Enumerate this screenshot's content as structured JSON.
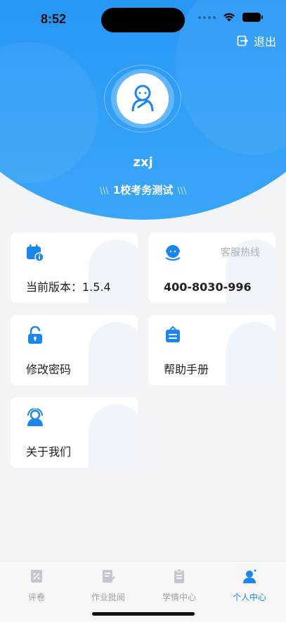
{
  "status_bar": {
    "time": "8:52"
  },
  "header": {
    "logout_label": "退出",
    "username": "zxj",
    "school_name": "1校考务测试",
    "slash_left": "\\\\\\",
    "slash_right": "\\\\\\"
  },
  "cards": {
    "version": {
      "label": "当前版本：1.5.4"
    },
    "hotline": {
      "title": "客服热线",
      "phone": "400-8030-996"
    },
    "change_password": {
      "label": "修改密码"
    },
    "help_manual": {
      "label": "帮助手册"
    },
    "about_us": {
      "label": "关于我们"
    }
  },
  "tabbar": {
    "items": [
      {
        "label": "评卷",
        "icon": "grading-icon"
      },
      {
        "label": "作业批阅",
        "icon": "homework-icon"
      },
      {
        "label": "学情中心",
        "icon": "clipboard-icon"
      },
      {
        "label": "个人中心",
        "icon": "person-icon"
      }
    ],
    "active_index": 3
  },
  "colors": {
    "accent": "#1a86ee",
    "header_gradient_start": "#1a86ee",
    "header_gradient_end": "#3aa6f8",
    "background": "#f3f4f7"
  }
}
